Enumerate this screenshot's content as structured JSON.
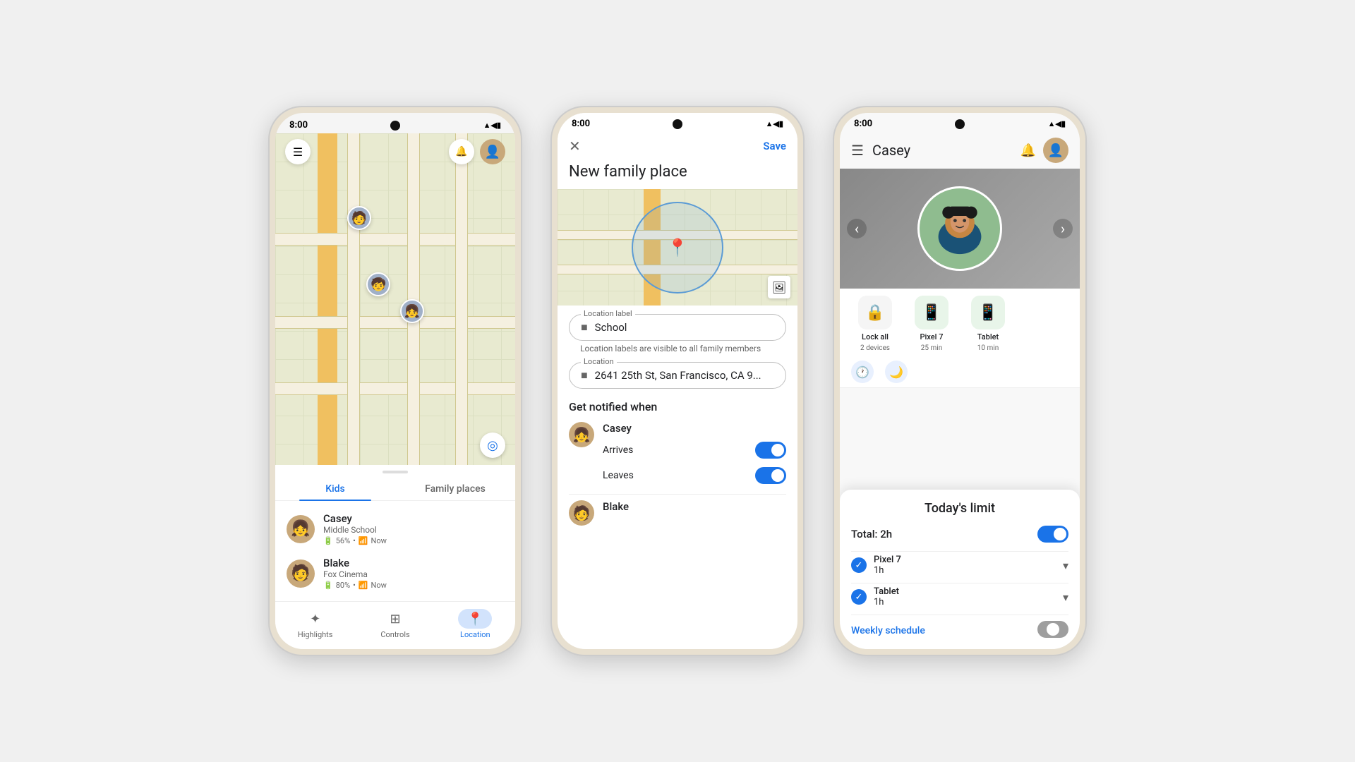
{
  "phone1": {
    "status": {
      "time": "8:00",
      "icons": "▲◀▮"
    },
    "map": {},
    "header": {
      "menu_icon": "☰",
      "bell_icon": "🔔",
      "avatar": "👤"
    },
    "tabs": [
      {
        "label": "Kids",
        "active": true
      },
      {
        "label": "Family places",
        "active": false
      }
    ],
    "kids": [
      {
        "name": "Casey",
        "location": "Middle School",
        "battery": "56%",
        "status": "Now"
      },
      {
        "name": "Blake",
        "location": "Fox Cinema",
        "battery": "80%",
        "status": "Now"
      }
    ],
    "nav": [
      {
        "label": "Highlights",
        "icon": "✦",
        "active": false
      },
      {
        "label": "Controls",
        "icon": "⊞",
        "active": false
      },
      {
        "label": "Location",
        "icon": "📍",
        "active": true
      }
    ]
  },
  "phone2": {
    "status": {
      "time": "8:00"
    },
    "header": {
      "close_icon": "✕",
      "title": "New family place",
      "save_label": "Save"
    },
    "location_label_field": {
      "label": "Location label",
      "value": "School",
      "icon": "■"
    },
    "location_hint": "Location labels are visible to all family members",
    "location_field": {
      "label": "Location",
      "value": "2641 25th St, San Francisco, CA 9...",
      "icon": "■"
    },
    "notify_section": "Get notified when",
    "people": [
      {
        "name": "Casey",
        "avatar": "👧",
        "toggles": [
          {
            "label": "Arrives",
            "on": true
          },
          {
            "label": "Leaves",
            "on": true
          }
        ]
      },
      {
        "name": "Blake",
        "avatar": "🧑"
      }
    ]
  },
  "phone3": {
    "status": {
      "time": "8:00"
    },
    "header": {
      "menu_icon": "☰",
      "name": "Casey",
      "bell_icon": "🔔",
      "avatar": "👤"
    },
    "profile": {
      "avatar": "👧"
    },
    "devices": [
      {
        "label": "Lock all",
        "sub": "2 devices",
        "icon": "🔒",
        "type": "lock"
      },
      {
        "label": "Pixel 7",
        "sub": "25 min",
        "icon": "📱",
        "type": "device"
      },
      {
        "label": "Tablet",
        "sub": "10 min",
        "icon": "📱",
        "type": "device"
      }
    ],
    "bottom_sheet": {
      "title": "Today's limit",
      "total_label": "Total: 2h",
      "devices": [
        {
          "device_name": "Pixel 7",
          "time": "1h"
        },
        {
          "device_name": "Tablet",
          "time": "1h"
        }
      ],
      "weekly_schedule_label": "Weekly schedule"
    }
  }
}
